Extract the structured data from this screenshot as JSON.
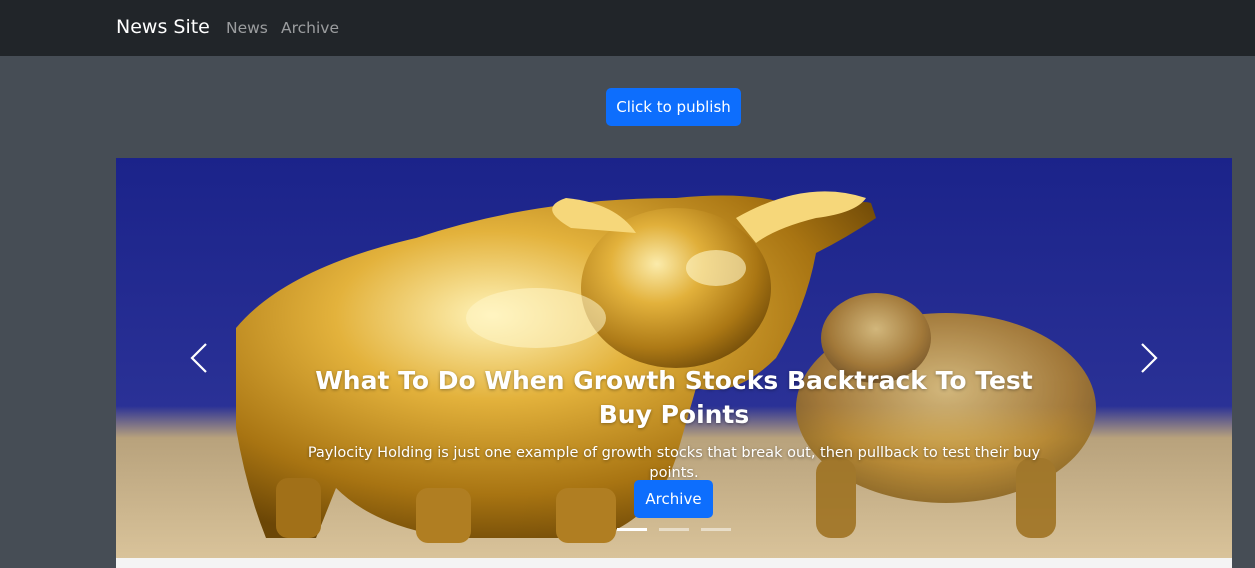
{
  "navbar": {
    "brand": "News Site",
    "links": [
      {
        "label": "News"
      },
      {
        "label": "Archive"
      }
    ]
  },
  "publish_button": {
    "label": "Click to publish"
  },
  "carousel": {
    "slide": {
      "title": "What To Do When Growth Stocks Backtrack To Test Buy Points",
      "text": "Paylocity Holding is just one example of growth stocks that break out, then pullback to test their buy points.",
      "button_label": "Archive",
      "image": "golden-bull-and-bear-icon"
    },
    "indicator_count": 3,
    "active_index": 0,
    "prev_icon": "chevron-left-icon",
    "next_icon": "chevron-right-icon"
  },
  "colors": {
    "navbar_bg": "#212529",
    "page_bg": "#464d55",
    "primary": "#0d6efd"
  }
}
